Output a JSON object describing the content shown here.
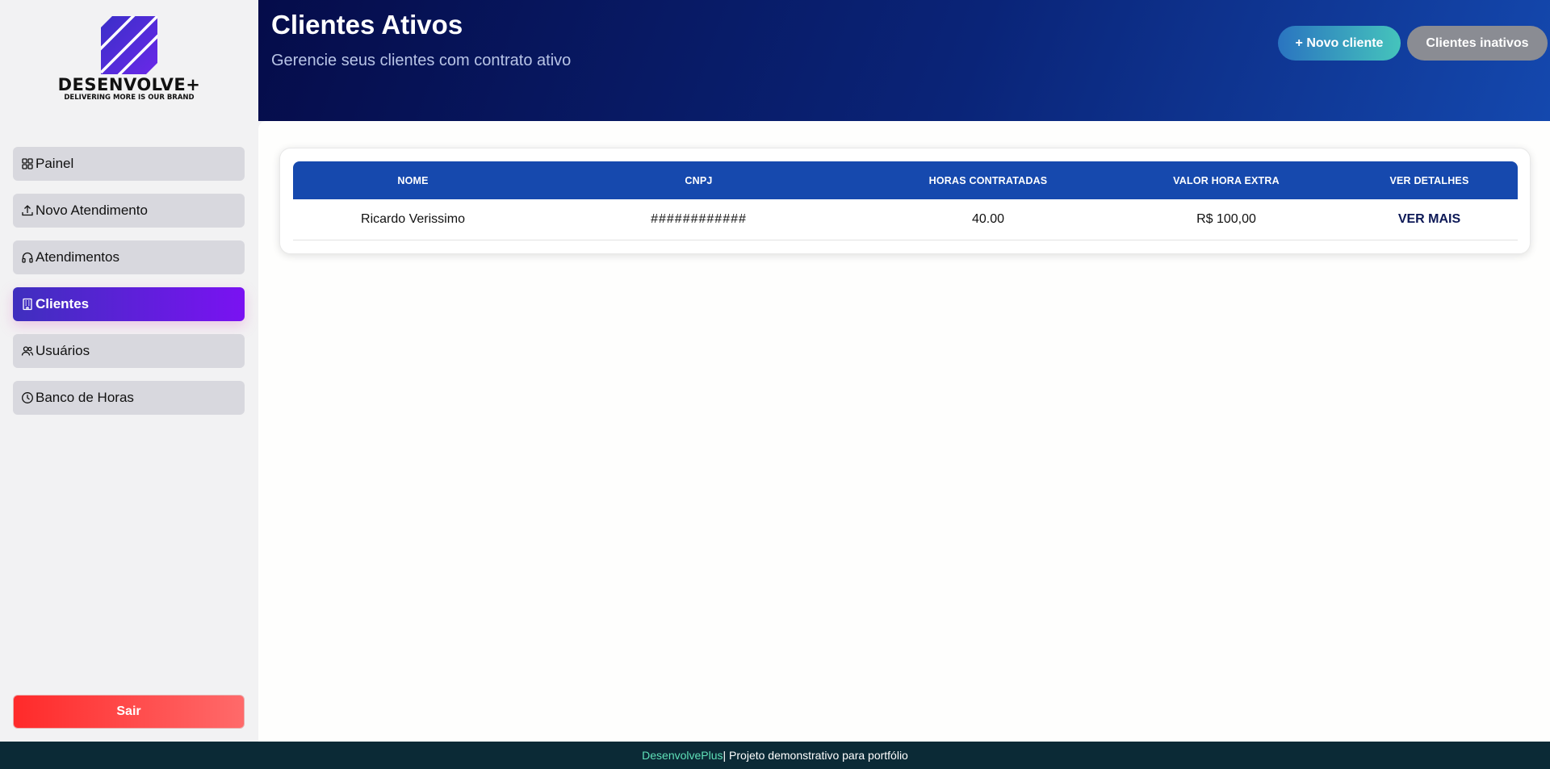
{
  "brand": {
    "name": "DESENVOLVE+",
    "tagline": "DELIVERING MORE IS OUR BRAND"
  },
  "sidebar": {
    "items": [
      {
        "label": "Painel",
        "icon": "grid-icon"
      },
      {
        "label": "Novo Atendimento",
        "icon": "upload-icon"
      },
      {
        "label": "Atendimentos",
        "icon": "headphones-icon"
      },
      {
        "label": "Clientes",
        "icon": "building-icon",
        "active": true
      },
      {
        "label": "Usuários",
        "icon": "users-icon"
      },
      {
        "label": "Banco de Horas",
        "icon": "clock-icon"
      }
    ],
    "logout_label": "Sair"
  },
  "header": {
    "title": "Clientes Ativos",
    "subtitle": "Gerencie seus clientes com contrato ativo",
    "new_client_label": "+ Novo cliente",
    "inactive_clients_label": "Clientes inativos"
  },
  "table": {
    "columns": [
      "NOME",
      "CNPJ",
      "HORAS CONTRATADAS",
      "VALOR HORA EXTRA",
      "VER DETALHES"
    ],
    "rows": [
      {
        "nome": "Ricardo Verissimo",
        "cnpj": "############",
        "horas": "40.00",
        "valor": "R$ 100,00",
        "acao": "VER MAIS"
      }
    ]
  },
  "footer": {
    "brand": "DesenvolvePlus",
    "text": " | Projeto demonstrativo para portfólio"
  },
  "colors": {
    "accent": "#1649ae",
    "active_nav_start": "#3f2fbe",
    "active_nav_end": "#7a12f2",
    "logout": "#ff2a2a",
    "footer_bg": "#0b2a36",
    "footer_brand": "#5fe0b8"
  }
}
